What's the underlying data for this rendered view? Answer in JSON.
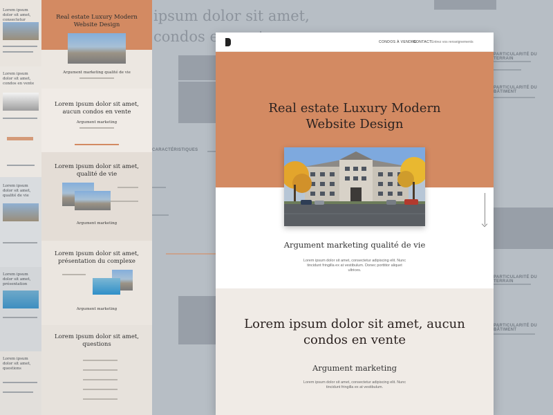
{
  "background": {
    "ghost_headline": "ipsum dolor sit amet, condos en vente",
    "right_labels": [
      "CARACTÉRISTIQUES",
      "PARTICULARITÉ DU TERRAIN",
      "PARTICULARITÉ DU BÂTIMENT",
      "PARTICULARITÉ DU TERRAIN",
      "PARTICULARITÉ DU BÂTIMENT"
    ],
    "left_titles": [
      "Lorem ipsum dolor sit amet, consectetur",
      "Lorem ipsum dolor sit amet, condos en vente",
      "Lorem ipsum dolor sit amet, qualité de vie",
      "Lorem ipsum dolor sit amet, présentation",
      "Lorem ipsum dolor sit amet, questions"
    ],
    "mid_sections": [
      {
        "title": "Real estate Luxury Modern Website Design",
        "sub": "Argument marketing qualité de vie"
      },
      {
        "title": "Lorem ipsum dolor sit amet, aucun condos en vente",
        "sub": "Argument marketing"
      },
      {
        "title": "Lorem ipsum dolor sit amet, qualité de vie",
        "sub": "Argument marketing"
      },
      {
        "title": "Lorem ipsum dolor sit amet, présentation du complexe",
        "sub": "Argument marketing"
      },
      {
        "title": "Lorem ipsum dolor sit amet, questions",
        "sub": ""
      }
    ]
  },
  "nav": {
    "logo": "logo-mark",
    "links": [
      "CONDOS À VENDRE",
      "CONTACT"
    ],
    "search_placeholder": "Entrez vos renseignements"
  },
  "hero": {
    "title": "Real estate Luxury Modern Website Design",
    "background_color": "#d38a62",
    "photo": "condo-building-photo"
  },
  "marketing": {
    "heading": "Argument marketing qualité de vie",
    "body": "Lorem ipsum dolor sit amet, consectetur adipiscing elit. Nunc tincidunt fringilla ex at vestibulum. Donec porttitor aliquet ultrices."
  },
  "section2": {
    "title": "Lorem ipsum dolor sit amet, aucun condos en vente",
    "subtitle": "Argument marketing",
    "body": "Lorem ipsum dolor sit amet, consectetur adipiscing elit. Nunc tincidunt fringilla ex at vestibulum.",
    "background_color": "#f0ebe6"
  },
  "accent_color": "#d38a62"
}
